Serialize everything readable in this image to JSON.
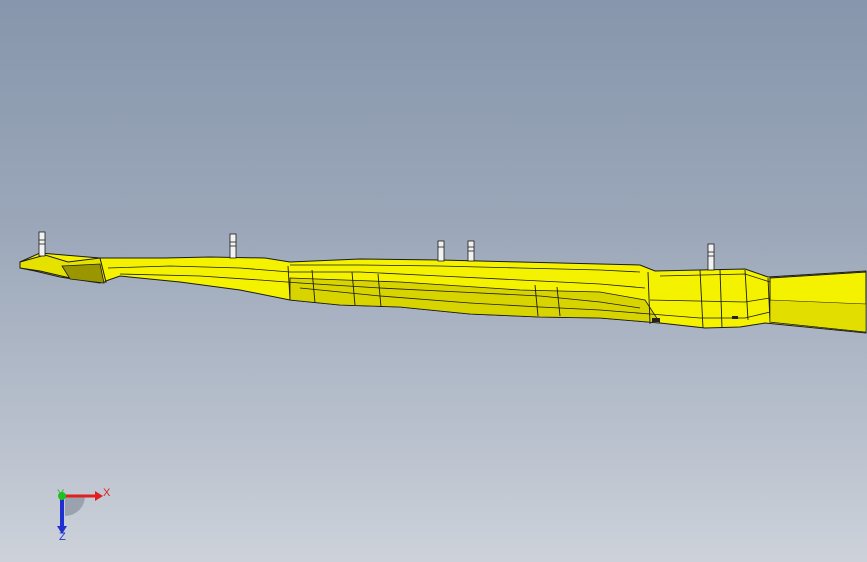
{
  "viewport": {
    "background_top": "#8796ac",
    "background_bottom": "#cdd2da"
  },
  "model": {
    "part_color": "#f5f200",
    "shade_color": "#d8d400",
    "edge_color": "#1a1a1a"
  },
  "triad": {
    "x_label": "X",
    "y_label": "Y",
    "z_label": "Z",
    "x_color": "#e02020",
    "y_color": "#20c020",
    "z_color": "#2030d0"
  }
}
